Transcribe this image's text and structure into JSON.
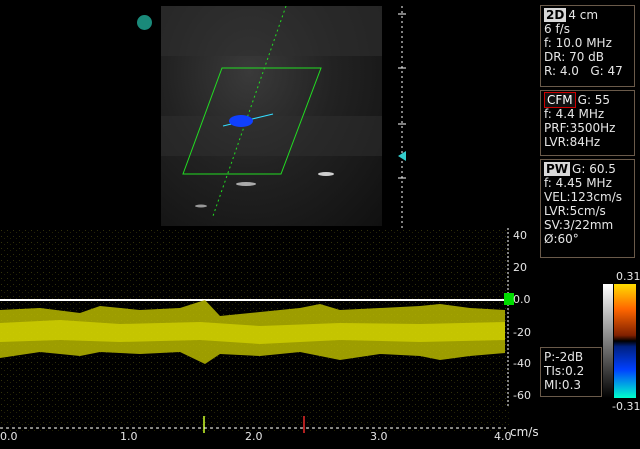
{
  "image_2d": {
    "fill": "#1c1c1c",
    "accent": "#00ff00"
  },
  "params_2d": {
    "mode": "2D",
    "depth": "4 cm",
    "frame_rate": "6 f/s",
    "frequency": "f: 10.0 MHz",
    "dynamic_range": "DR: 70 dB",
    "resolution": "R: 4.0",
    "gain": "G: 47"
  },
  "params_cfm": {
    "mode": "CFM",
    "gain": "G: 55",
    "frequency": "f: 4.4 MHz",
    "prf": "PRF:3500Hz",
    "lvr": "LVR:84Hz"
  },
  "params_pw": {
    "mode": "PW",
    "gain": "G: 60.5",
    "frequency": "f: 4.45 MHz",
    "velocity": "VEL:123cm/s",
    "lvr": "LVR:5cm/s",
    "sample_volume": "SV:3/22mm",
    "angle": "Ø:60°"
  },
  "power": {
    "p": "P:-2dB",
    "tis": "TIs:0.2",
    "mi": "MI:0.3"
  },
  "color_scale": {
    "top": "0.31",
    "bottom": "-0.31"
  },
  "doppler": {
    "y_ticks": [
      "40",
      "20",
      "0.0",
      "-20",
      "-40",
      "-60"
    ],
    "x_ticks": [
      "0.0",
      "1.0",
      "2.0",
      "3.0",
      "4.0"
    ],
    "x_unit": "cm/s",
    "trace_color": "#e6e600"
  }
}
